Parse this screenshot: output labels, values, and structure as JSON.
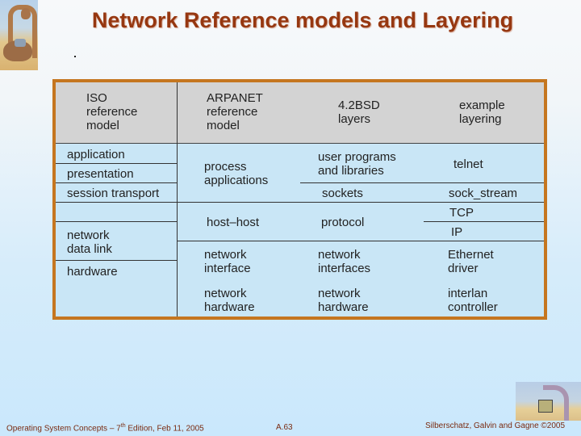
{
  "title": "Network Reference models and Layering",
  "icons": {
    "top_left": "dinosaur-logo-icon",
    "bottom_right": "dinosaur-laptop-icon"
  },
  "colors": {
    "title": "#963710",
    "frame_border": "#c5761f",
    "header_bg": "#d3d3d3",
    "body_bg": "#c9e6f6"
  },
  "table": {
    "headers": [
      "ISO\nreference\nmodel",
      "ARPANET\nreference\nmodel",
      "4.2BSD\nlayers",
      "example\nlayering"
    ],
    "iso": {
      "application": "application",
      "presentation": "presentation",
      "session_transport": "session transport",
      "network_data_link": "network\ndata link",
      "hardware": "hardware"
    },
    "arpanet": {
      "process_applications": "process\napplications",
      "host_host": "host–host",
      "network_interface": "network\ninterface",
      "network_hardware": "network\nhardware"
    },
    "bsd": {
      "user_programs": "user programs\nand libraries",
      "sockets": "sockets",
      "protocol": "protocol",
      "network_interfaces": "network\ninterfaces",
      "network_hardware": "network\nhardware"
    },
    "example": {
      "telnet": "telnet",
      "sock_stream": "sock_stream",
      "tcp": "TCP",
      "ip": "IP",
      "ethernet_driver": "Ethernet\ndriver",
      "interlan_controller": "interlan\ncontroller"
    }
  },
  "footer": {
    "left_prefix": "Operating System Concepts – 7",
    "left_sup": "th",
    "left_suffix": " Edition, Feb 11, 2005",
    "page": "A.63",
    "copyright": "Silberschatz, Galvin and Gagne ©2005"
  }
}
